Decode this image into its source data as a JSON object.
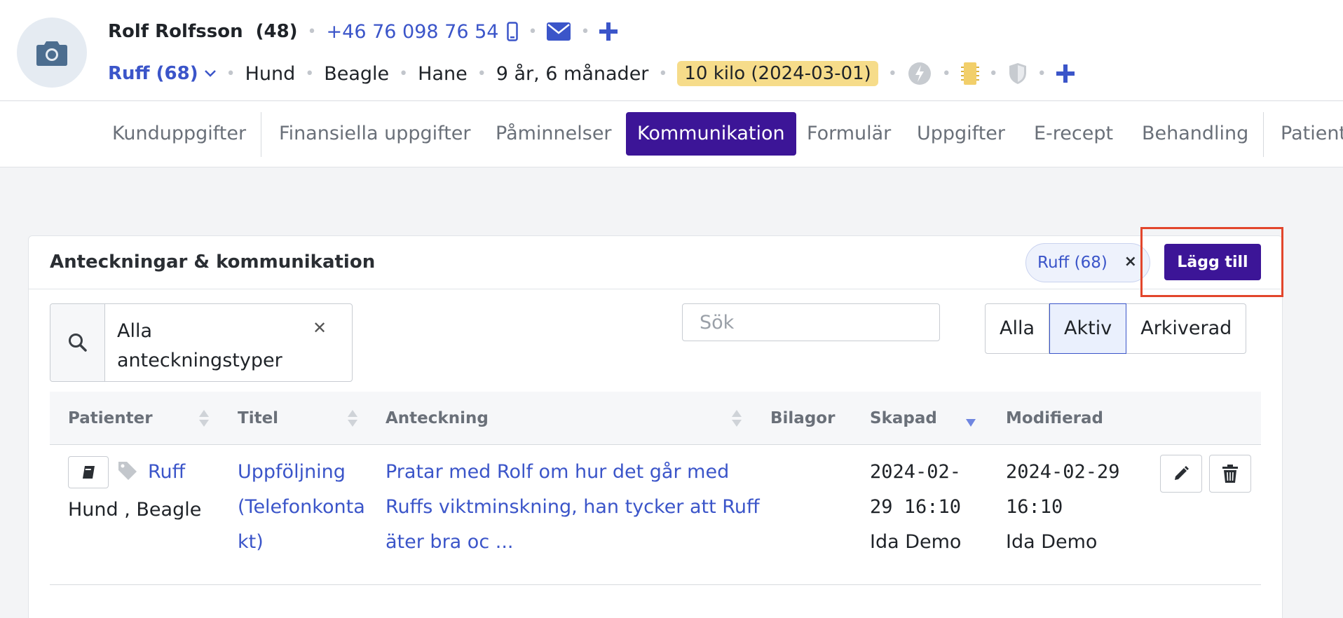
{
  "header": {
    "owner_name": "Rolf Rolfsson",
    "owner_age": "(48)",
    "phone": "+46 76 098 76 54",
    "pet_name": "Ruff (68)",
    "species": "Hund",
    "breed": "Beagle",
    "sex": "Hane",
    "age": "9 år, 6 månader",
    "weight": "10 kilo (2024-03-01)"
  },
  "tabs": [
    "Kunduppgifter",
    "Finansiella uppgifter",
    "Påminnelser",
    "Kommunikation",
    "Formulär",
    "Uppgifter",
    "E-recept",
    "Behandling",
    "Patient"
  ],
  "card": {
    "title": "Anteckningar & kommunikation",
    "patient_filter": "Ruff (68)",
    "add_label": "Lägg till",
    "type_filter": "Alla anteckningstyper",
    "search_placeholder": "Sök",
    "status_filters": [
      "Alla",
      "Aktiv",
      "Arkiverad"
    ],
    "active_status": "Aktiv"
  },
  "table": {
    "columns": [
      "Patienter",
      "Titel",
      "Anteckning",
      "Bilagor",
      "Skapad",
      "Modifierad"
    ],
    "rows": [
      {
        "patient": "Ruff",
        "patient_meta": "Hund , Beagle",
        "title_l1": "Uppföljning",
        "title_l2": "(Telefonkonta",
        "title_l3": "kt)",
        "note_l1": "Pratar med Rolf om hur det går med",
        "note_l2": "Ruffs viktminskning, han tycker att Ruff",
        "note_l3": "äter bra oc ...",
        "created_l1": "2024-02-",
        "created_l2": "29 16:10",
        "created_by": "Ida Demo",
        "modified_l1": "2024-02-29",
        "modified_l2": "16:10",
        "modified_by": "Ida Demo"
      }
    ]
  },
  "colors": {
    "primary": "#3c1597",
    "link": "#3b55c9",
    "weight_badge": "#f6dc8a",
    "highlight": "#e2462c"
  }
}
